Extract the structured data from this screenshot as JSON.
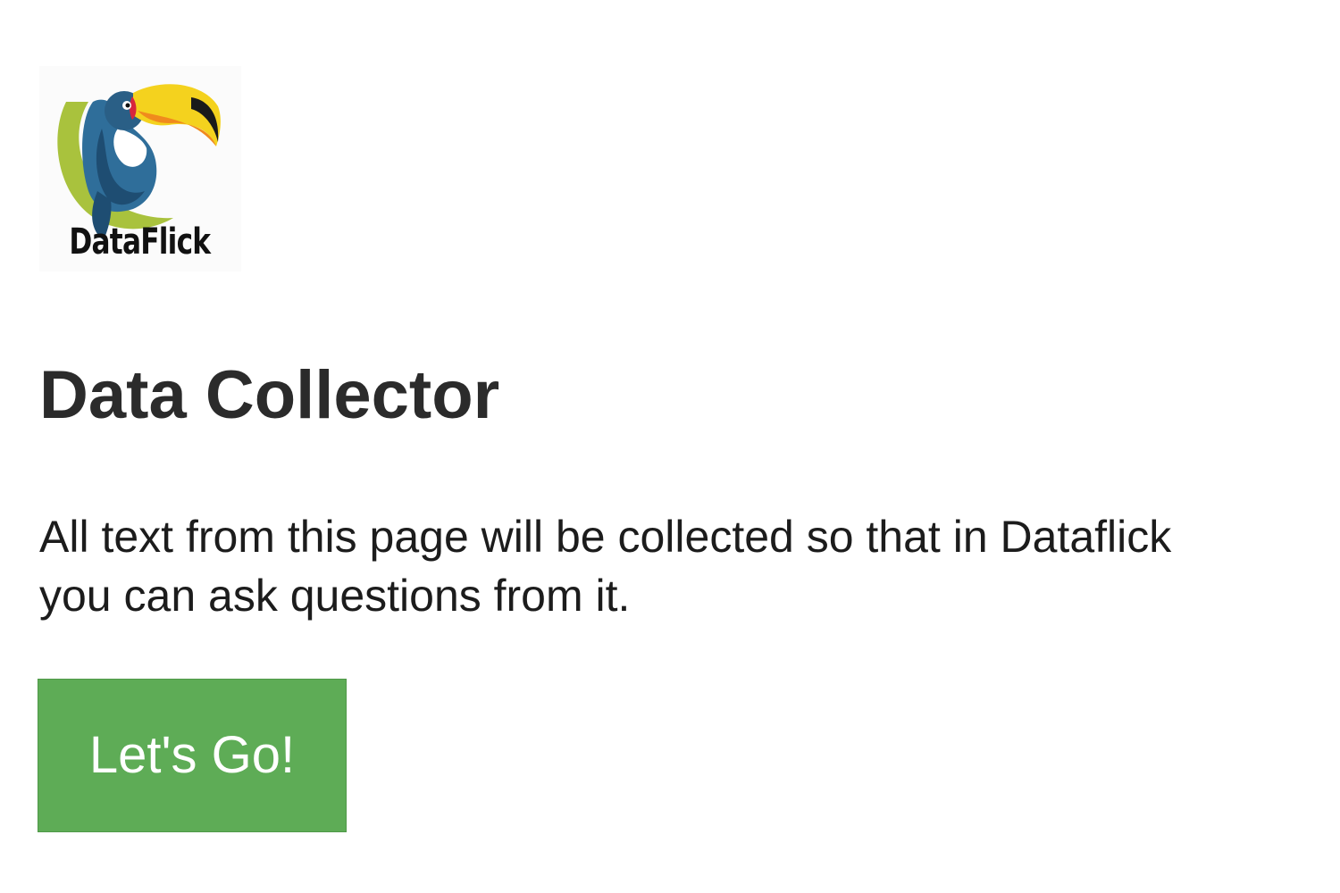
{
  "logo": {
    "brand_name": "DataFlick",
    "icon": "toucan-logo-icon"
  },
  "heading": {
    "title": "Data Collector"
  },
  "content": {
    "description": "All text from this page will be collected so that in Dataflick you can ask questions from it."
  },
  "actions": {
    "go_label": "Let's Go!"
  },
  "colors": {
    "button_bg": "#5eac56",
    "button_text": "#ffffff",
    "title_text": "#2b2b2b",
    "body_text": "#1c1c1c",
    "logo_green": "#a9c23d",
    "logo_beak_yellow": "#f4d21e",
    "logo_beak_orange": "#f08a1d",
    "logo_body_blue": "#2f6e9a"
  }
}
